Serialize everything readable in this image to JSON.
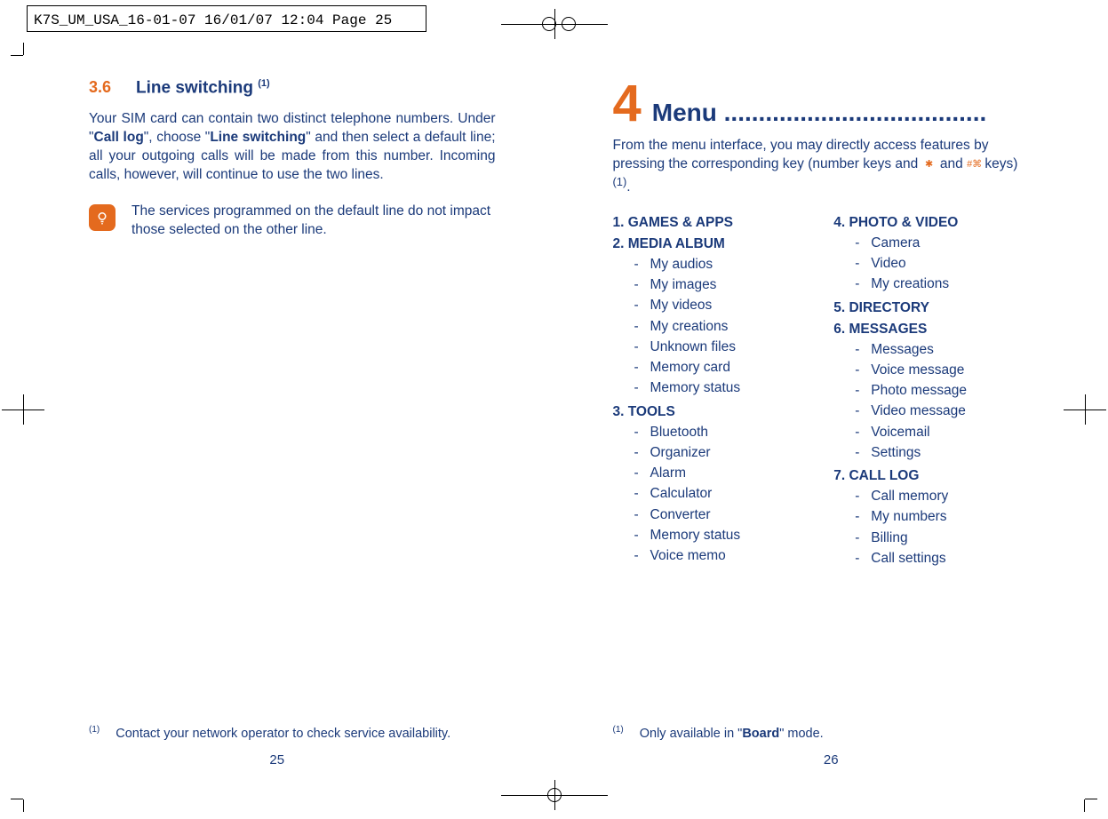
{
  "slug": "K7S_UM_USA_16-01-07  16/01/07  12:04  Page 25",
  "left_page": {
    "num": "3.6",
    "title": "Line switching ",
    "title_sup": "(1)",
    "para_parts": {
      "a": "Your SIM card can contain two distinct telephone numbers. Under \"",
      "b": "Call log",
      "c": "\", choose \"",
      "d": "Line switching",
      "e": "\" and then select a default line; all your outgoing calls will be made from this number. Incoming calls, however, will continue to use the two lines."
    },
    "note": "The services programmed on the default line do not impact those selected on the other line.",
    "footnote_mark": "(1)",
    "footnote": "Contact your network operator to check service availability.",
    "page_num": "25"
  },
  "right_page": {
    "chapter_num": "4",
    "chapter_title": "Menu ......................................",
    "intro_a": "From the menu interface, you may directly access features by pressing the corresponding key (number keys and ",
    "intro_b": " and ",
    "intro_c": " keys) ",
    "intro_sup": "(1)",
    "intro_d": ".",
    "menu_left": [
      {
        "cat": "1. GAMES & APPS",
        "items": []
      },
      {
        "cat": "2. MEDIA ALBUM",
        "items": [
          "My audios",
          "My images",
          "My videos",
          "My creations",
          "Unknown files",
          "Memory card",
          "Memory status"
        ]
      },
      {
        "cat": "3. TOOLS",
        "items": [
          "Bluetooth",
          "Organizer",
          "Alarm",
          "Calculator",
          "Converter",
          "Memory status",
          "Voice memo"
        ]
      }
    ],
    "menu_right": [
      {
        "cat": "4. PHOTO & VIDEO",
        "items": [
          "Camera",
          "Video",
          "My creations"
        ]
      },
      {
        "cat": "5. DIRECTORY",
        "items": []
      },
      {
        "cat": "6. MESSAGES",
        "items": [
          "Messages",
          "Voice message",
          "Photo message",
          "Video message",
          "Voicemail",
          "Settings"
        ]
      },
      {
        "cat": "7. CALL LOG",
        "items": [
          "Call memory",
          "My numbers",
          "Billing",
          "Call settings"
        ]
      }
    ],
    "footnote_mark": "(1)",
    "footnote_a": "Only available in \"",
    "footnote_b": "Board",
    "footnote_c": "\" mode.",
    "page_num": "26"
  }
}
